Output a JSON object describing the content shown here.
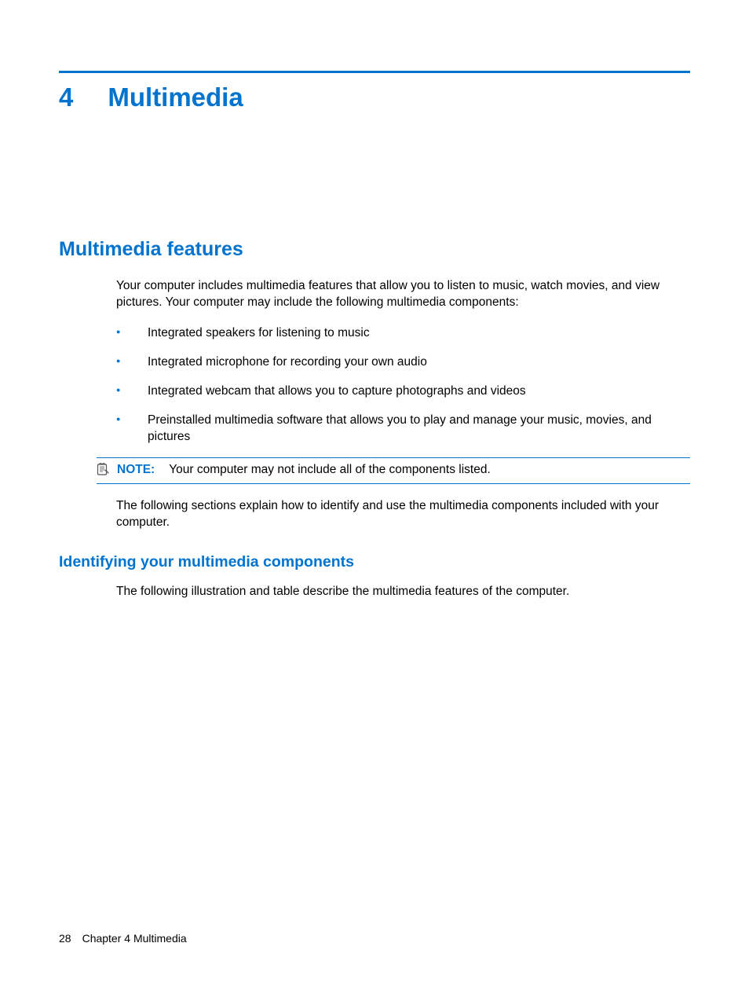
{
  "chapter": {
    "number": "4",
    "title": "Multimedia"
  },
  "section": {
    "heading": "Multimedia features",
    "intro": "Your computer includes multimedia features that allow you to listen to music, watch movies, and view pictures. Your computer may include the following multimedia components:",
    "bullets": [
      "Integrated speakers for listening to music",
      "Integrated microphone for recording your own audio",
      "Integrated webcam that allows you to capture photographs and videos",
      "Preinstalled multimedia software that allows you to play and manage your music, movies, and pictures"
    ],
    "note": {
      "label": "NOTE:",
      "text": "Your computer may not include all of the components listed."
    },
    "after_note": "The following sections explain how to identify and use the multimedia components included with your computer."
  },
  "subsection": {
    "heading": "Identifying your multimedia components",
    "text": "The following illustration and table describe the multimedia features of the computer."
  },
  "footer": {
    "page": "28",
    "chapter_label": "Chapter 4   Multimedia"
  }
}
